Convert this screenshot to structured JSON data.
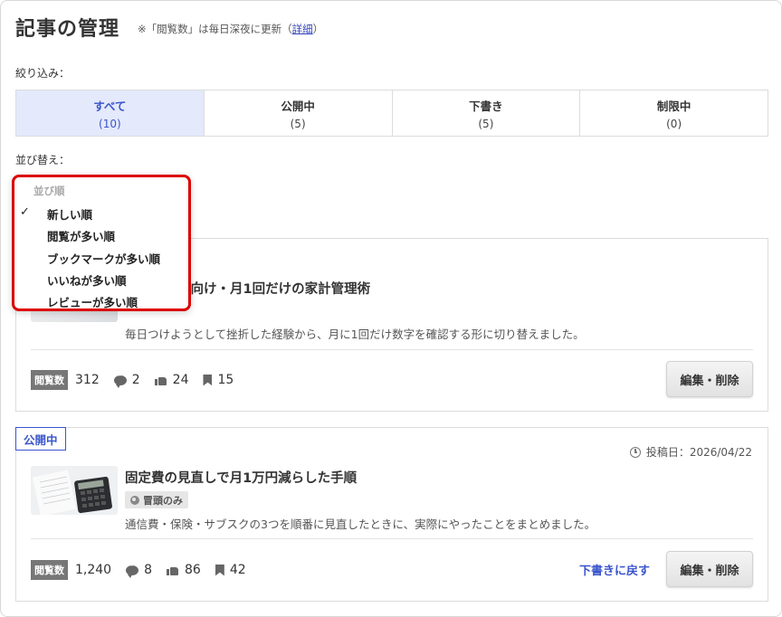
{
  "header": {
    "title": "記事の管理",
    "note_prefix": "※「閲覧数」は毎日深夜に更新（",
    "note_link": "詳細",
    "note_suffix": "）"
  },
  "filter": {
    "label": "絞り込み：",
    "tabs": [
      {
        "label": "すべて",
        "count": "(10)",
        "active": true
      },
      {
        "label": "公開中",
        "count": "(5)",
        "active": false
      },
      {
        "label": "下書き",
        "count": "(5)",
        "active": false
      },
      {
        "label": "制限中",
        "count": "(0)",
        "active": false
      }
    ]
  },
  "sort": {
    "label": "並び替え：",
    "header": "並び順",
    "selected_index": 0,
    "options": [
      "新しい順",
      "閲覧が多い順",
      "ブックマークが多い順",
      "いいねが多い順",
      "レビューが多い順"
    ]
  },
  "articles": [
    {
      "title_visible": "続かない人向け・月1回だけの家計管理術",
      "excerpt": "毎日つけようとして挫折した経験から、月に1回だけ数字を確認する形に切り替えました。",
      "views_label": "閲覧数",
      "views": "312",
      "comments": "2",
      "likes": "24",
      "bookmarks": "15",
      "edit_label": "編集・削除"
    },
    {
      "status": "公開中",
      "date": "投稿日：2026/04/22",
      "title": "固定費の見直しで月1万円減らした手順",
      "scope": "冒頭のみ",
      "excerpt": "通信費・保険・サブスクの3つを順番に見直したときに、実際にやったことをまとめました。",
      "views_label": "閲覧数",
      "views": "1,240",
      "comments": "8",
      "likes": "86",
      "bookmarks": "42",
      "revert_label": "下書きに戻す",
      "edit_label": "編集・削除"
    }
  ],
  "colors": {
    "accent": "#3a55cc",
    "active_tab_bg": "#e4e9fb",
    "highlight_border": "#dd0000"
  }
}
